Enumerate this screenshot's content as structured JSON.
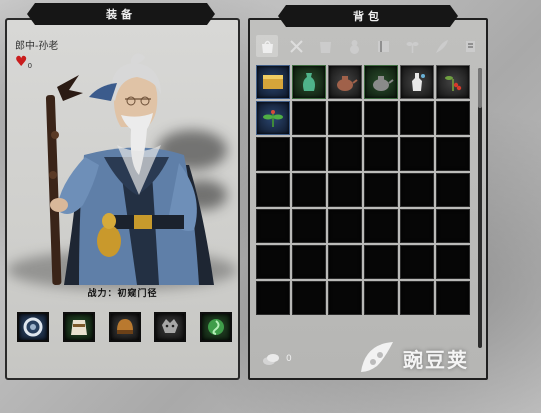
{
  "equipment": {
    "title": "装备",
    "character_name": "郎中-孙老",
    "heart_count": "0",
    "power_label": "战力：初窥门径",
    "slots": [
      {
        "name": "accessory",
        "icon": "ring-icon",
        "color": "#2f4a6e"
      },
      {
        "name": "armor",
        "icon": "robe-icon",
        "color": "#264a28"
      },
      {
        "name": "helmet",
        "icon": "helmet-icon",
        "color": "#3a3a3a"
      },
      {
        "name": "mount",
        "icon": "beast-icon",
        "color": "#3a3a3a"
      },
      {
        "name": "jade",
        "icon": "jade-pendant-icon",
        "color": "#264a28"
      }
    ]
  },
  "bag": {
    "title": "背包",
    "tabs": [
      {
        "name": "all",
        "icon": "bag-all-icon",
        "active": true
      },
      {
        "name": "weapon",
        "icon": "crossed-swords-icon",
        "active": false
      },
      {
        "name": "armor",
        "icon": "armor-icon",
        "active": false
      },
      {
        "name": "misc",
        "icon": "gourd-icon",
        "active": false
      },
      {
        "name": "book",
        "icon": "book-icon",
        "active": false
      },
      {
        "name": "herb",
        "icon": "herb-icon",
        "active": false
      },
      {
        "name": "material",
        "icon": "feather-icon",
        "active": false
      },
      {
        "name": "quest",
        "icon": "scroll-icon",
        "active": false
      }
    ],
    "items": [
      {
        "icon": "gold-box-icon",
        "rarity": "blue"
      },
      {
        "icon": "green-vase-icon",
        "rarity": "green"
      },
      {
        "icon": "teapot-icon",
        "rarity": "gray"
      },
      {
        "icon": "dark-teapot-icon",
        "rarity": "green"
      },
      {
        "icon": "white-bottle-icon",
        "rarity": "gray"
      },
      {
        "icon": "red-fruit-herb-icon",
        "rarity": "gray"
      },
      {
        "icon": "herb-plant-icon",
        "rarity": "blue"
      }
    ],
    "total_cells": 42,
    "money": "0"
  },
  "watermark": {
    "text": "豌豆荚"
  }
}
